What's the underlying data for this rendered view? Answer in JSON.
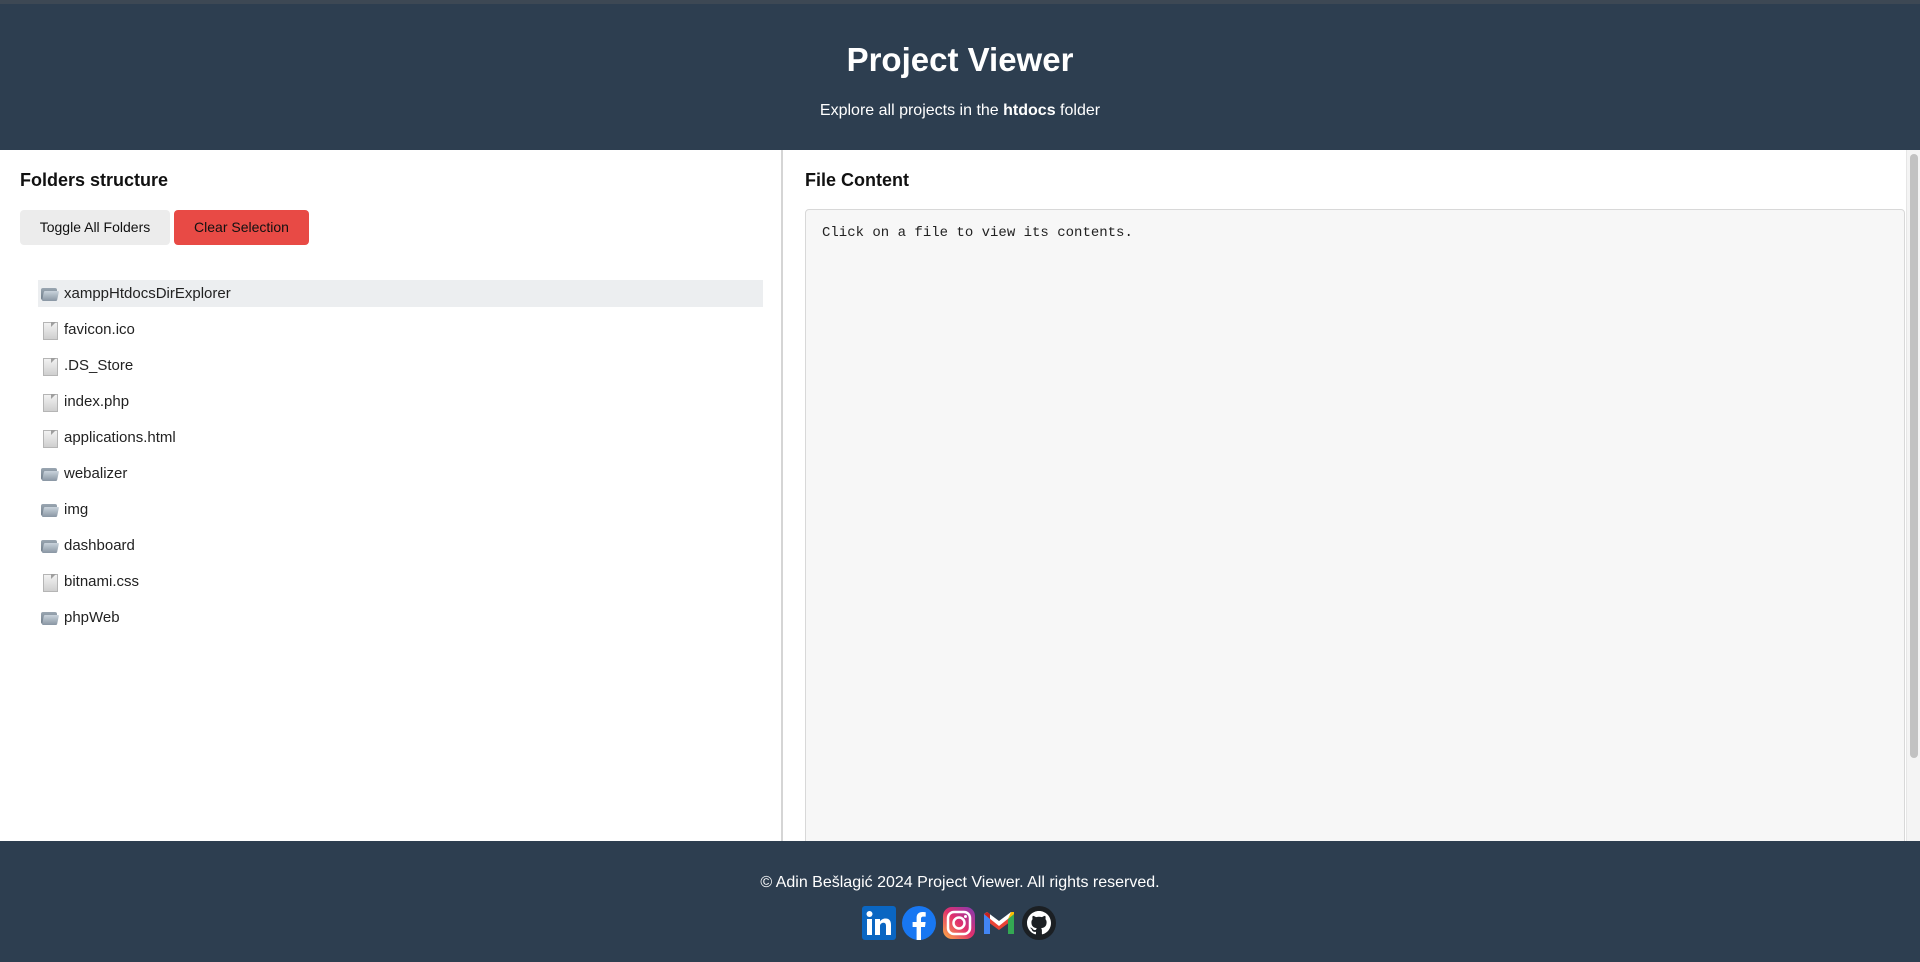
{
  "header": {
    "title": "Project Viewer",
    "subtitle_prefix": "Explore all projects in the",
    "subtitle_bold": "htdocs",
    "subtitle_suffix": "folder"
  },
  "left_panel": {
    "title": "Folders structure",
    "toggle_label": "Toggle All Folders",
    "clear_label": "Clear Selection",
    "items": [
      {
        "name": "xamppHtdocsDirExplorer",
        "type": "folder",
        "selected": true
      },
      {
        "name": "favicon.ico",
        "type": "file"
      },
      {
        "name": ".DS_Store",
        "type": "file"
      },
      {
        "name": "index.php",
        "type": "file"
      },
      {
        "name": "applications.html",
        "type": "file"
      },
      {
        "name": "webalizer",
        "type": "folder"
      },
      {
        "name": "img",
        "type": "folder"
      },
      {
        "name": "dashboard",
        "type": "folder"
      },
      {
        "name": "bitnami.css",
        "type": "file"
      },
      {
        "name": "phpWeb",
        "type": "folder"
      }
    ]
  },
  "right_panel": {
    "title": "File Content",
    "placeholder": "Click on a file to view its contents."
  },
  "footer": {
    "copyright": "© Adin Bešlagić 2024 Project Viewer. All rights reserved.",
    "socials": [
      "linkedin-icon",
      "facebook-icon",
      "instagram-icon",
      "gmail-icon",
      "github-icon"
    ]
  },
  "colors": {
    "header_bg": "#2d3e50",
    "clear_button": "#e84a45",
    "toggle_button": "#ececec",
    "selected_row": "#eceef0"
  }
}
